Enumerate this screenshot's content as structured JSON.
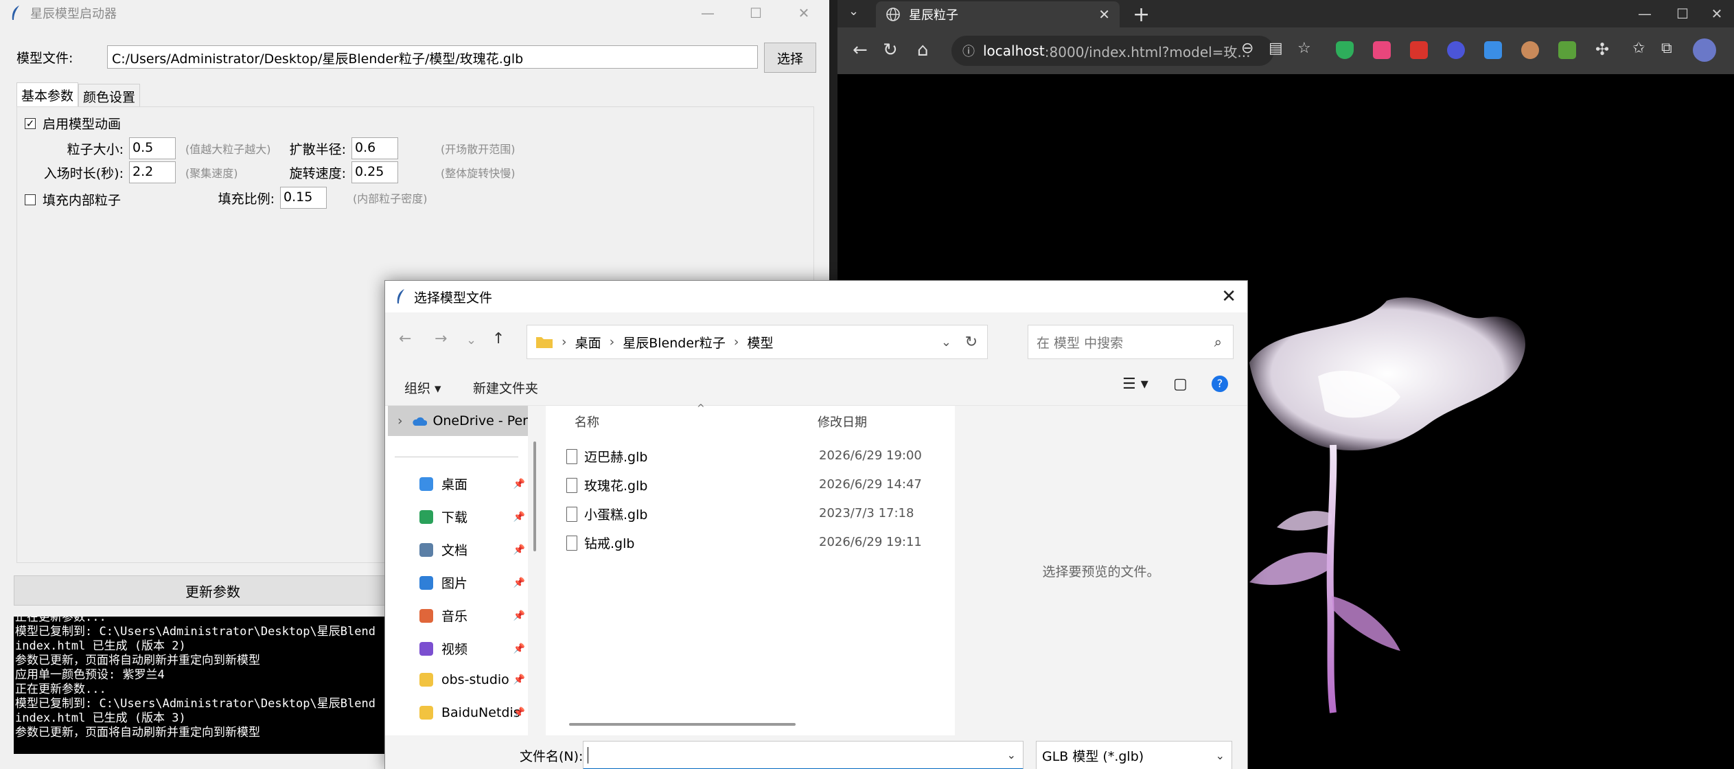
{
  "launcher": {
    "title": "星辰模型启动器",
    "model_label": "模型文件:",
    "model_path": "C:/Users/Administrator/Desktop/星辰Blender粒子/模型/玫瑰花.glb",
    "select_button": "选择",
    "tabs": [
      {
        "label": "基本参数"
      },
      {
        "label": "颜色设置"
      }
    ],
    "enable_animation": {
      "label": "启用模型动画",
      "checked": true,
      "mark": "✓"
    },
    "fields": {
      "particle_size": {
        "label": "粒子大小:",
        "value": "0.5",
        "hint": "(值越大粒子越大)"
      },
      "spread_radius": {
        "label": "扩散半径:",
        "value": "0.6",
        "hint": "(开场散开范围)"
      },
      "entry_duration": {
        "label": "入场时长(秒):",
        "value": "2.2",
        "hint": "(聚集速度)"
      },
      "rotation_speed": {
        "label": "旋转速度:",
        "value": "0.25",
        "hint": "(整体旋转快慢)"
      },
      "fill_ratio": {
        "label": "填充比例:",
        "value": "0.15",
        "hint": "(内部粒子密度)"
      }
    },
    "fill_inner": {
      "label": "填充内部粒子",
      "checked": false
    },
    "update_button": "更新参数",
    "console_lines": [
      "正在更新参数...",
      "模型已复制到: C:\\Users\\Administrator\\Desktop\\星辰Blend",
      "index.html 已生成 (版本 2)",
      "参数已更新，页面将自动刷新并重定向到新模型",
      "应用单一颜色预设: 紫罗兰4",
      "正在更新参数...",
      "模型已复制到: C:\\Users\\Administrator\\Desktop\\星辰Blend",
      "index.html 已生成 (版本 3)",
      "参数已更新，页面将自动刷新并重定向到新模型"
    ]
  },
  "browser": {
    "tab_title": "星辰粒子",
    "url_host": "localhost",
    "url_rest": ":8000/index.html?model=玫..."
  },
  "dialog": {
    "title": "选择模型文件",
    "breadcrumbs": [
      "桌面",
      "星辰Blender粒子",
      "模型"
    ],
    "search_placeholder": "在 模型 中搜索",
    "organize": "组织 ▾",
    "new_folder": "新建文件夹",
    "nav": {
      "onedrive": "OneDrive - Per",
      "items": [
        {
          "label": "桌面",
          "color": "#3a8ee6"
        },
        {
          "label": "下载",
          "color": "#2aa15a"
        },
        {
          "label": "文档",
          "color": "#5b7fa6"
        },
        {
          "label": "图片",
          "color": "#2f7fd8"
        },
        {
          "label": "音乐",
          "color": "#e0663a"
        },
        {
          "label": "视频",
          "color": "#7b4fd0"
        },
        {
          "label": "obs-studio",
          "color": "#f2c340"
        },
        {
          "label": "BaiduNetdis",
          "color": "#f2c340"
        }
      ]
    },
    "columns": {
      "name": "名称",
      "date": "修改日期"
    },
    "files": [
      {
        "name": "迈巴赫.glb",
        "date": "2026/6/29 19:00"
      },
      {
        "name": "玫瑰花.glb",
        "date": "2026/6/29 14:47"
      },
      {
        "name": "小蛋糕.glb",
        "date": "2023/7/3 17:18"
      },
      {
        "name": "钻戒.glb",
        "date": "2026/6/29 19:11"
      }
    ],
    "preview_text": "选择要预览的文件。",
    "filename_label": "文件名(N):",
    "filename_value": "",
    "filetype": "GLB 模型 (*.glb)"
  }
}
